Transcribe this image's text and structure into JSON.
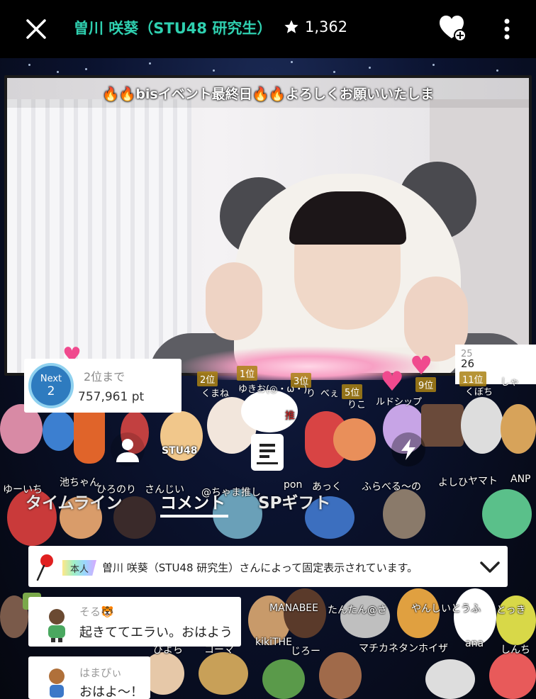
{
  "header": {
    "title": "曽川 咲葵（STU48 研究生）",
    "star_count": "1,362"
  },
  "video": {
    "ticker": "🔥🔥bisイベント最終日🔥🔥よろしくお願いいたしま"
  },
  "ranking": {
    "next_label": "Next",
    "next_rank": "2",
    "until_label": "2位まで",
    "points": "757,961 pt",
    "side_rank_prev": "25",
    "side_rank": "26",
    "tags": [
      "2位",
      "1位",
      "3位",
      "5位",
      "9位",
      "11位"
    ],
    "names": [
      "くまね",
      "ゆきお(◎・ω・)",
      "り",
      "べぇ",
      "りこ",
      "ルドシップ",
      "くぼち",
      "しゃ"
    ]
  },
  "tabs": {
    "timeline": "タイムライン",
    "comment": "コメント",
    "gift": "SPギフト"
  },
  "crowd_names": [
    "ゆーいち",
    "池ちゃん",
    "ひろのり",
    "さんじい",
    "@ちゃま推し",
    "pon",
    "あっく",
    "ふらべる～の",
    "よしひ",
    "ヤマト",
    "ANP",
    "MANABEE",
    "たんたん@さ",
    "やんしいとうふ",
    "とっき",
    "kikiTHE",
    "じろー",
    "マチカネタンホイザ",
    "ana",
    "しんち",
    "ぴよら",
    "コーマ",
    "STU48",
    "推"
  ],
  "pinned": {
    "badge": "本人",
    "text": "曽川 咲葵（STU48 研究生）さんによって固定表示されています。"
  },
  "comments": [
    {
      "user": "そる🐯",
      "message": "起きててエラい。おはよう"
    },
    {
      "user": "はまぴぃ",
      "message": "おはよ～！"
    }
  ],
  "colors": {
    "title_green": "#2fd0b0",
    "topbar_bg": "#000000",
    "next_circle": "#2e7bbf"
  }
}
